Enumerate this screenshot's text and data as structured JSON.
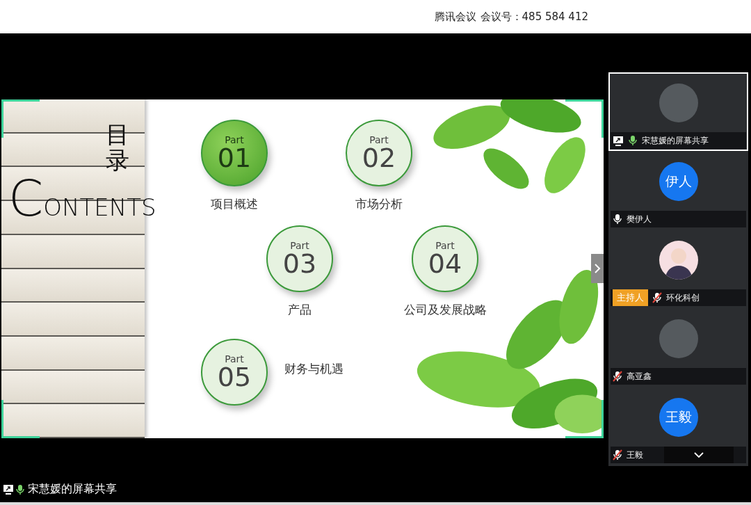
{
  "header": {
    "app_name": "腾讯会议",
    "meeting_id": "会议号：485 584 412"
  },
  "slide": {
    "title_cn": "目录",
    "title_en": "CONTENTS",
    "parts": [
      {
        "tag": "Part",
        "number": "01",
        "label": "项目概述",
        "highlighted": true
      },
      {
        "tag": "Part",
        "number": "02",
        "label": "市场分析",
        "highlighted": false
      },
      {
        "tag": "Part",
        "number": "03",
        "label": "产品",
        "highlighted": false
      },
      {
        "tag": "Part",
        "number": "04",
        "label": "公司及发展战略",
        "highlighted": false
      },
      {
        "tag": "Part",
        "number": "05",
        "label": "财务与机遇",
        "highlighted": false
      }
    ]
  },
  "participants": [
    {
      "name": "宋慧媛的屏幕共享",
      "avatar": {
        "kind": "photo"
      },
      "speaking": true,
      "muted": false,
      "sharing": true,
      "selected": true
    },
    {
      "name": "樊伊人",
      "avatar": {
        "kind": "initials",
        "text": "伊人"
      },
      "speaking": false,
      "muted": false,
      "sharing": false,
      "selected": false
    },
    {
      "name": "环化科创",
      "avatar": {
        "kind": "cartoon"
      },
      "speaking": false,
      "muted": true,
      "sharing": false,
      "selected": false,
      "badge": "主持人"
    },
    {
      "name": "高亚鑫",
      "avatar": {
        "kind": "photo"
      },
      "speaking": false,
      "muted": true,
      "sharing": false,
      "selected": false
    },
    {
      "name": "王毅",
      "avatar": {
        "kind": "initials",
        "text": "王毅"
      },
      "speaking": false,
      "muted": true,
      "sharing": false,
      "selected": false
    }
  ],
  "status": {
    "sharing": true,
    "speaking": true,
    "muted": false,
    "label": "宋慧媛的屏幕共享"
  }
}
